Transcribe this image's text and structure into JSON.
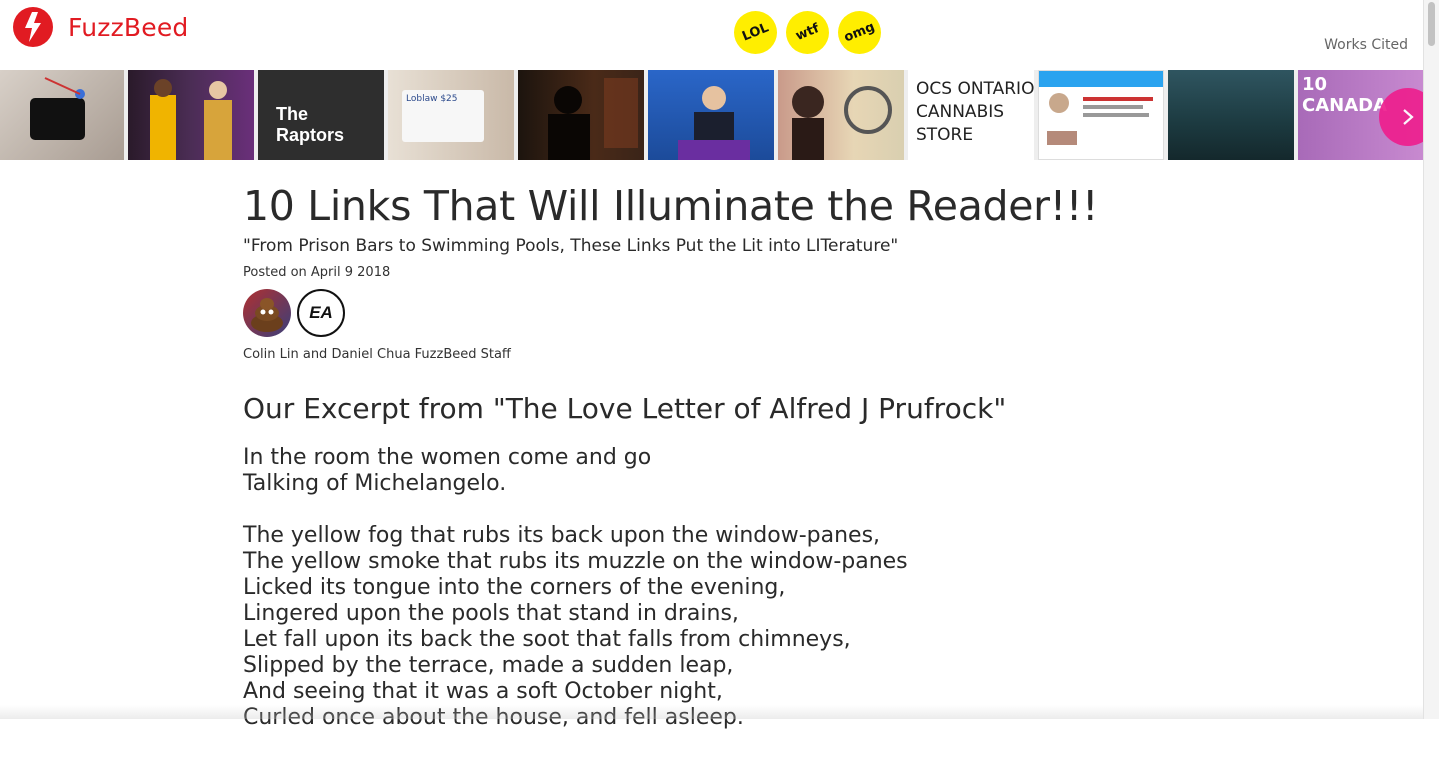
{
  "brand": {
    "name": "FuzzBeed",
    "color": "#e11b22"
  },
  "header": {
    "badges": [
      "LOL",
      "wtf",
      "omg"
    ],
    "badge_color": "#ffee00",
    "works_cited": "Works Cited"
  },
  "carousel": {
    "items": [
      {
        "label": ""
      },
      {
        "label": ""
      },
      {
        "label": "The Raptors"
      },
      {
        "label": "Loblaw $25"
      },
      {
        "label": ""
      },
      {
        "label": ""
      },
      {
        "label": ""
      },
      {
        "label": "OCS ONTARIO CANNABIS STORE"
      },
      {
        "label": ""
      },
      {
        "label": ""
      },
      {
        "label": "10 CANADA"
      }
    ],
    "next_icon": "chevron-right-icon",
    "next_color": "#ee1f8e"
  },
  "article": {
    "title": "10 Links That Will Illuminate the Reader!!!",
    "subtitle": "\"From Prison Bars to Swimming Pools, These Links Put the Lit into LITerature\"",
    "posted": "Posted on April 9 2018",
    "byline": "Colin Lin and Daniel Chua FuzzBeed Staff",
    "avatar_ea_text": "EA",
    "section_heading": "Our Excerpt from \"The Love Letter of Alfred J Prufrock\"",
    "poem": {
      "stanza1": [
        "In the room the women come and go",
        "Talking of Michelangelo."
      ],
      "stanza2": [
        "The yellow fog that rubs its back upon the window-panes,",
        "The yellow smoke that rubs its muzzle on the window-panes",
        "Licked its tongue into the corners of the evening,",
        "Lingered upon the pools that stand in drains,",
        "Let fall upon its back the soot that falls from chimneys,",
        "Slipped by the terrace, made a sudden leap,",
        "And seeing that it was a soft October night,",
        "Curled once about the house, and fell asleep."
      ]
    }
  }
}
